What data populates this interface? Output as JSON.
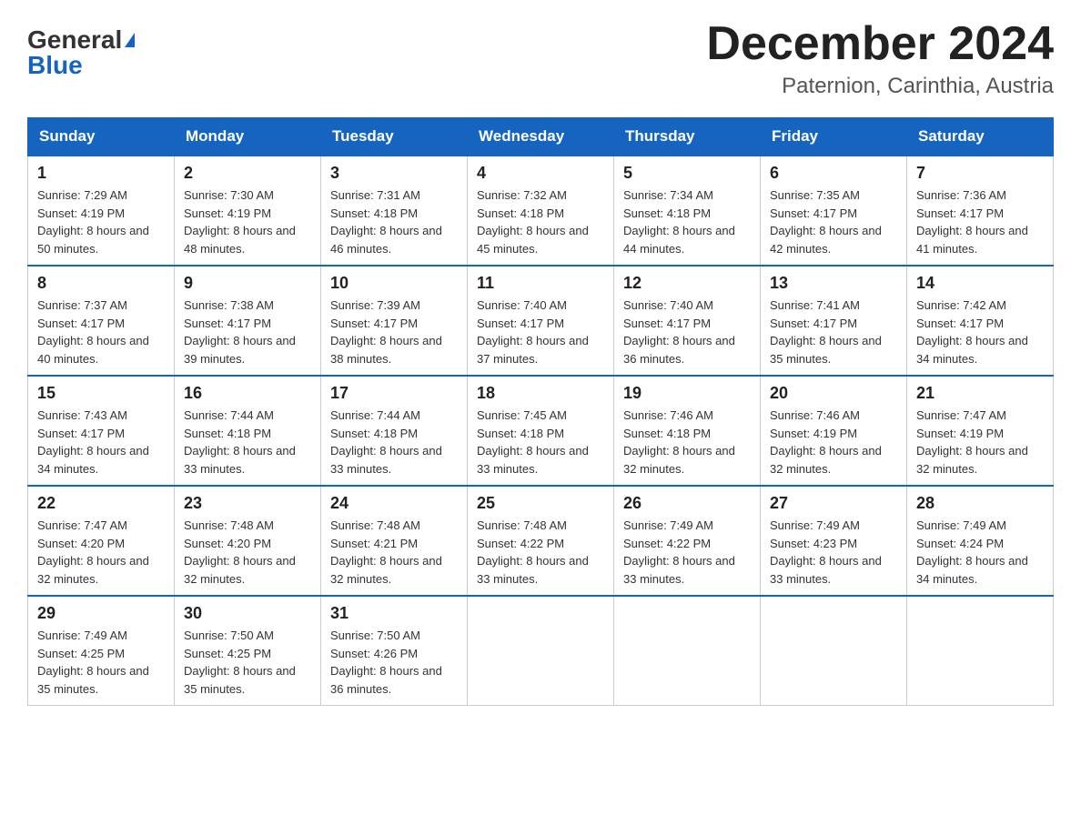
{
  "header": {
    "logo_general": "General",
    "logo_blue": "Blue",
    "month_year": "December 2024",
    "location": "Paternion, Carinthia, Austria"
  },
  "weekdays": [
    "Sunday",
    "Monday",
    "Tuesday",
    "Wednesday",
    "Thursday",
    "Friday",
    "Saturday"
  ],
  "weeks": [
    [
      {
        "day": "1",
        "sunrise": "7:29 AM",
        "sunset": "4:19 PM",
        "daylight": "8 hours and 50 minutes."
      },
      {
        "day": "2",
        "sunrise": "7:30 AM",
        "sunset": "4:19 PM",
        "daylight": "8 hours and 48 minutes."
      },
      {
        "day": "3",
        "sunrise": "7:31 AM",
        "sunset": "4:18 PM",
        "daylight": "8 hours and 46 minutes."
      },
      {
        "day": "4",
        "sunrise": "7:32 AM",
        "sunset": "4:18 PM",
        "daylight": "8 hours and 45 minutes."
      },
      {
        "day": "5",
        "sunrise": "7:34 AM",
        "sunset": "4:18 PM",
        "daylight": "8 hours and 44 minutes."
      },
      {
        "day": "6",
        "sunrise": "7:35 AM",
        "sunset": "4:17 PM",
        "daylight": "8 hours and 42 minutes."
      },
      {
        "day": "7",
        "sunrise": "7:36 AM",
        "sunset": "4:17 PM",
        "daylight": "8 hours and 41 minutes."
      }
    ],
    [
      {
        "day": "8",
        "sunrise": "7:37 AM",
        "sunset": "4:17 PM",
        "daylight": "8 hours and 40 minutes."
      },
      {
        "day": "9",
        "sunrise": "7:38 AM",
        "sunset": "4:17 PM",
        "daylight": "8 hours and 39 minutes."
      },
      {
        "day": "10",
        "sunrise": "7:39 AM",
        "sunset": "4:17 PM",
        "daylight": "8 hours and 38 minutes."
      },
      {
        "day": "11",
        "sunrise": "7:40 AM",
        "sunset": "4:17 PM",
        "daylight": "8 hours and 37 minutes."
      },
      {
        "day": "12",
        "sunrise": "7:40 AM",
        "sunset": "4:17 PM",
        "daylight": "8 hours and 36 minutes."
      },
      {
        "day": "13",
        "sunrise": "7:41 AM",
        "sunset": "4:17 PM",
        "daylight": "8 hours and 35 minutes."
      },
      {
        "day": "14",
        "sunrise": "7:42 AM",
        "sunset": "4:17 PM",
        "daylight": "8 hours and 34 minutes."
      }
    ],
    [
      {
        "day": "15",
        "sunrise": "7:43 AM",
        "sunset": "4:17 PM",
        "daylight": "8 hours and 34 minutes."
      },
      {
        "day": "16",
        "sunrise": "7:44 AM",
        "sunset": "4:18 PM",
        "daylight": "8 hours and 33 minutes."
      },
      {
        "day": "17",
        "sunrise": "7:44 AM",
        "sunset": "4:18 PM",
        "daylight": "8 hours and 33 minutes."
      },
      {
        "day": "18",
        "sunrise": "7:45 AM",
        "sunset": "4:18 PM",
        "daylight": "8 hours and 33 minutes."
      },
      {
        "day": "19",
        "sunrise": "7:46 AM",
        "sunset": "4:18 PM",
        "daylight": "8 hours and 32 minutes."
      },
      {
        "day": "20",
        "sunrise": "7:46 AM",
        "sunset": "4:19 PM",
        "daylight": "8 hours and 32 minutes."
      },
      {
        "day": "21",
        "sunrise": "7:47 AM",
        "sunset": "4:19 PM",
        "daylight": "8 hours and 32 minutes."
      }
    ],
    [
      {
        "day": "22",
        "sunrise": "7:47 AM",
        "sunset": "4:20 PM",
        "daylight": "8 hours and 32 minutes."
      },
      {
        "day": "23",
        "sunrise": "7:48 AM",
        "sunset": "4:20 PM",
        "daylight": "8 hours and 32 minutes."
      },
      {
        "day": "24",
        "sunrise": "7:48 AM",
        "sunset": "4:21 PM",
        "daylight": "8 hours and 32 minutes."
      },
      {
        "day": "25",
        "sunrise": "7:48 AM",
        "sunset": "4:22 PM",
        "daylight": "8 hours and 33 minutes."
      },
      {
        "day": "26",
        "sunrise": "7:49 AM",
        "sunset": "4:22 PM",
        "daylight": "8 hours and 33 minutes."
      },
      {
        "day": "27",
        "sunrise": "7:49 AM",
        "sunset": "4:23 PM",
        "daylight": "8 hours and 33 minutes."
      },
      {
        "day": "28",
        "sunrise": "7:49 AM",
        "sunset": "4:24 PM",
        "daylight": "8 hours and 34 minutes."
      }
    ],
    [
      {
        "day": "29",
        "sunrise": "7:49 AM",
        "sunset": "4:25 PM",
        "daylight": "8 hours and 35 minutes."
      },
      {
        "day": "30",
        "sunrise": "7:50 AM",
        "sunset": "4:25 PM",
        "daylight": "8 hours and 35 minutes."
      },
      {
        "day": "31",
        "sunrise": "7:50 AM",
        "sunset": "4:26 PM",
        "daylight": "8 hours and 36 minutes."
      },
      null,
      null,
      null,
      null
    ]
  ]
}
